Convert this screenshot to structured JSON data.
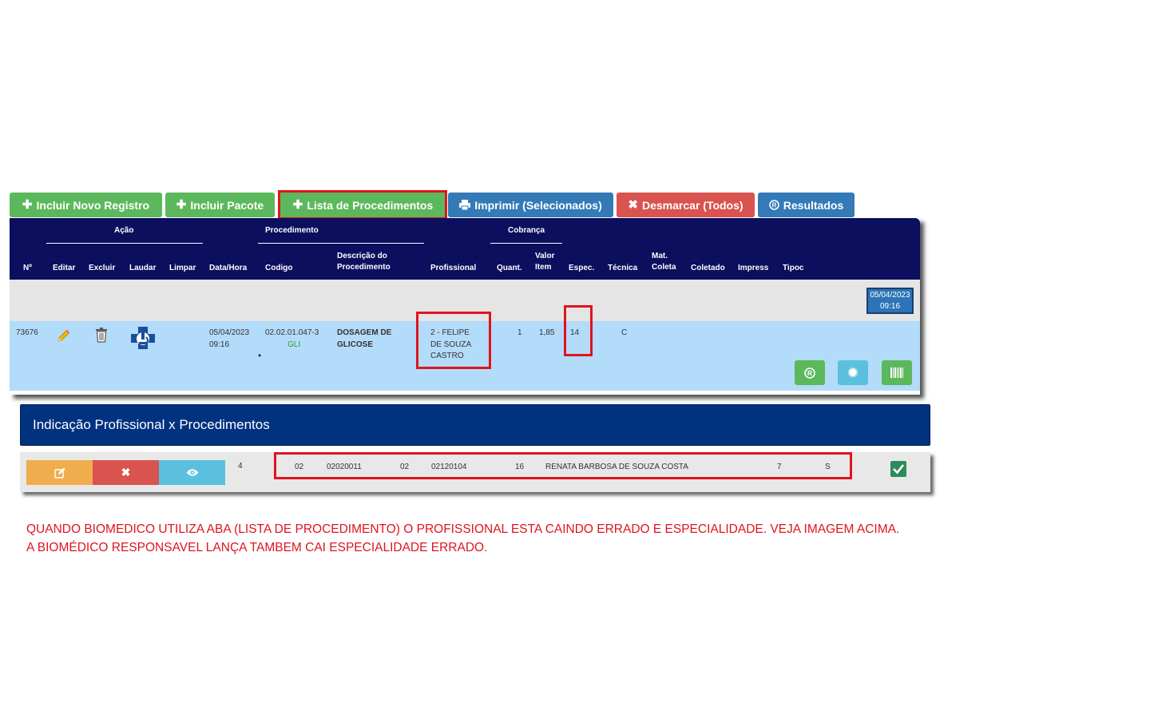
{
  "toolbar": {
    "new_record": "Incluir Novo Registro",
    "include_package": "Incluir Pacote",
    "procedure_list": "Lista de Procedimentos",
    "print_selected": "Imprimir (Selecionados)",
    "unmark_all": "Desmarcar (Todos)",
    "results": "Resultados"
  },
  "table": {
    "groups": {
      "acao": "Ação",
      "procedimento": "Procedimento",
      "cobranca": "Cobrança"
    },
    "headers": {
      "num": "Nº",
      "editar": "Editar",
      "excluir": "Excluir",
      "laudar": "Laudar",
      "limpar": "Limpar",
      "datahora": "Data/Hora",
      "codigo": "Codigo",
      "descricao_1": "Descrição do",
      "descricao_2": "Procedimento",
      "profissional": "Profissional",
      "quant": "Quant.",
      "valor_1": "Valor",
      "valor_2": "Item",
      "espec": "Espec.",
      "tecnica": "Técnica",
      "mat_1": "Mat.",
      "mat_2": "Coleta",
      "coletado": "Coletado",
      "impress": "Impress",
      "tipoc": "Tipoc"
    },
    "group_date": {
      "date": "05/04/2023",
      "time": "09:16"
    },
    "row": {
      "num": "73676",
      "date": "05/04/2023",
      "time": "09:16",
      "code": "02.02.01.047-3",
      "code_tag": "GLI",
      "desc_1": "DOSAGEM DE",
      "desc_2": "GLICOSE",
      "prof_1": "2 - FELIPE",
      "prof_2": "DE SOUZA",
      "prof_3": "CASTRO",
      "quant": "1",
      "valor": "1,85",
      "espec": "14",
      "tecnica": "C"
    }
  },
  "indicacao": {
    "title": "Indicação Profissional x Procedimentos",
    "row": {
      "n": "4",
      "c1": "02",
      "c2": "02020011",
      "c3": "02",
      "c4": "02120104",
      "c5": "16",
      "name": "RENATA BARBOSA DE SOUZA COSTA",
      "c6": "7",
      "c7": "S"
    }
  },
  "message": {
    "line1": "QUANDO BIOMEDICO UTILIZA ABA (LISTA DE PROCEDIMENTO) O PROFISSIONAL ESTA CAINDO ERRADO E ESPECIALIDADE. VEJA IMAGEM ACIMA.",
    "line2": "A BIOMÉDICO RESPONSAVEL LANÇA TAMBEM CAI ESPECIALIDADE ERRADO."
  },
  "colors": {
    "green": "#5cb85c",
    "blue": "#337ab7",
    "red": "#d9534f",
    "header_navy": "#0c0e5e",
    "row_blue": "#b3dbfa",
    "highlight_red": "#e0141e",
    "indicacao_navy": "#003280",
    "orange": "#f0ad4e",
    "cyan": "#5bc0de"
  },
  "icons": {
    "new_record": "plus-icon",
    "include_package": "plus-icon",
    "procedure_list": "plus-icon",
    "print": "printer-icon",
    "unmark": "times-icon",
    "results": "registered-icon",
    "edit": "pencil-icon",
    "delete": "trash-icon",
    "laudar": "microscope-icon",
    "result_action": "registered-icon",
    "asterisk": "asterisk-icon",
    "barcode": "barcode-icon",
    "ind_edit": "edit-square-icon",
    "ind_delete": "times-icon",
    "ind_view": "eye-icon",
    "ind_check": "check-square-icon"
  }
}
